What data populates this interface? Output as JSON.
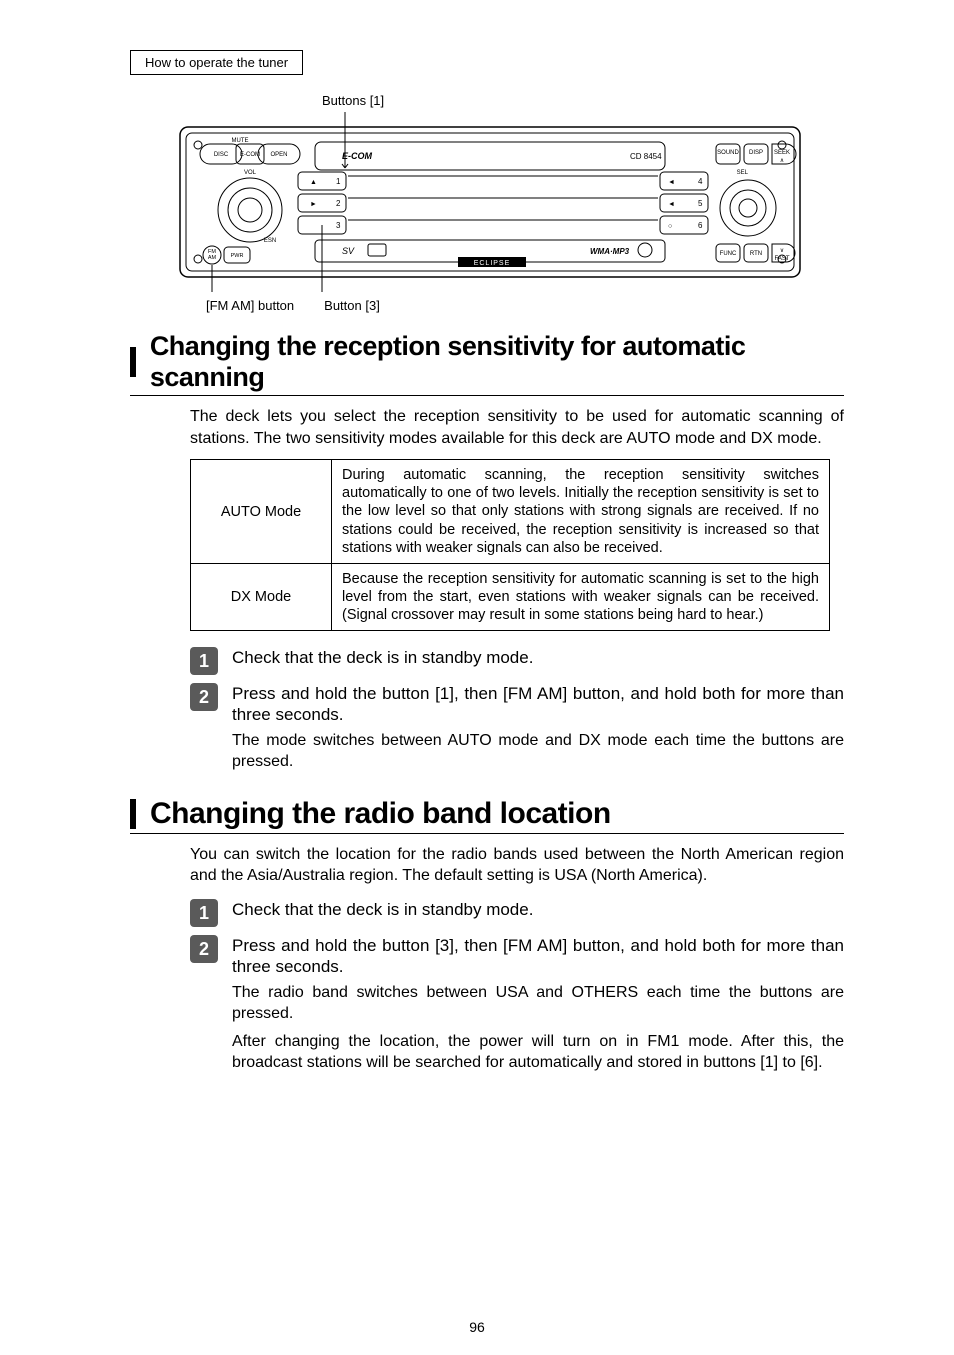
{
  "breadcrumb": "How to operate the tuner",
  "annotations": {
    "top": "Buttons [1]",
    "bottom_left": "[FM AM] button",
    "bottom_right": "Button [3]"
  },
  "section1": {
    "title": "Changing the reception sensitivity for automatic scanning",
    "intro": "The deck lets you select the reception sensitivity to be used for automatic scanning of stations. The two sensitivity modes available for this deck are AUTO mode and DX mode.",
    "table": [
      {
        "mode": "AUTO Mode",
        "desc": "During automatic scanning, the reception sensitivity switches automatically to one of two levels. Initially the reception sensitivity is set to the low level so that only stations with strong signals are received. If no stations could be received, the reception sensitivity is increased so that stations with weaker signals can also be received."
      },
      {
        "mode": "DX Mode",
        "desc": "Because the reception sensitivity for automatic scanning is set to the high level from the start, even stations with weaker signals can be received. (Signal crossover may result in some stations being hard to hear.)"
      }
    ],
    "steps": [
      {
        "n": "1",
        "title": "Check that the deck is in standby mode."
      },
      {
        "n": "2",
        "title": "Press and hold the button [1], then [FM AM] button, and hold both for more than three seconds.",
        "note": "The mode switches between AUTO mode and DX mode each time the buttons are pressed."
      }
    ]
  },
  "section2": {
    "title": "Changing the radio band location",
    "intro": "You can switch the location for the radio bands used between the North American region and the Asia/Australia region. The default setting is USA (North America).",
    "steps": [
      {
        "n": "1",
        "title": "Check that the deck is in standby mode."
      },
      {
        "n": "2",
        "title": "Press and hold the button [3], then [FM AM] button, and hold both for more than three seconds.",
        "notes": [
          "The radio band switches between USA and OTHERS each time the buttons are pressed.",
          "After changing the location, the power will turn on in FM1 mode. After this, the broadcast stations will be searched for automatically and stored in buttons [1] to [6]."
        ]
      }
    ]
  },
  "page_number": "96",
  "device_labels": {
    "mute": "MUTE",
    "disc": "DISC",
    "ecom": "E-COM",
    "open": "OPEN",
    "vol": "VOL",
    "esn": "ESN",
    "fmam": "FM\nAM",
    "pwr": "PWR",
    "ecom_italic": "E-COM",
    "cd": "CD 8454",
    "wma": "WMA·MP3",
    "eclipse": "ECLIPSE",
    "sound": "SOUND",
    "disp": "DISP",
    "seek": "SEEK",
    "sel": "SEL",
    "func": "FUNC",
    "rtn": "RTN",
    "fast": "FAST",
    "b1": "1",
    "b2": "2",
    "b3": "3",
    "b4": "4",
    "b5": "5",
    "b6": "6",
    "tri_up": "▲",
    "tri_right": "►",
    "tri_left": "◄",
    "circ": "○"
  }
}
